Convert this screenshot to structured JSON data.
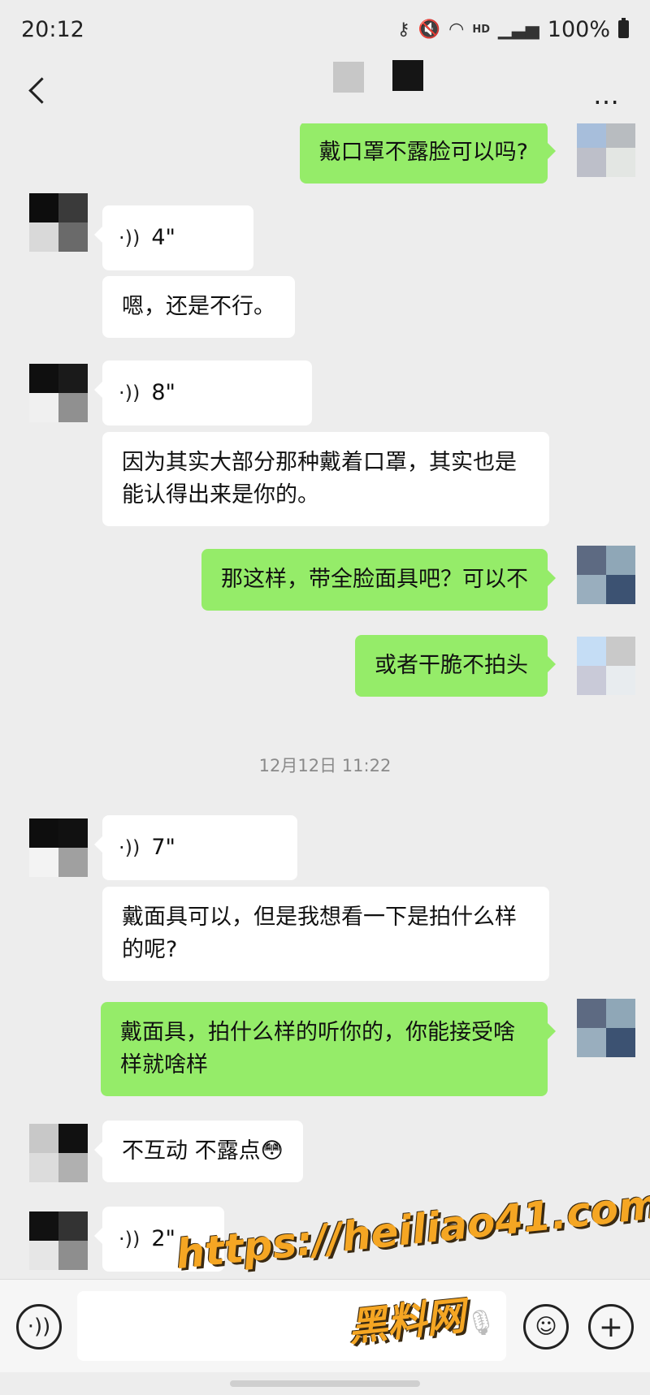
{
  "status_bar": {
    "time": "20:12",
    "battery": "100%",
    "icons": [
      "key-icon",
      "mute-icon",
      "wifi-icon",
      "hd-icon",
      "signal-icon",
      "battery-icon"
    ],
    "hd_label": "HD"
  },
  "nav": {
    "back_icon": "chevron-left-icon",
    "more_label": "…"
  },
  "messages": [
    {
      "side": "out",
      "type": "text",
      "text": "戴口罩不露脸可以吗?"
    },
    {
      "side": "in",
      "type": "voice",
      "duration": "4\""
    },
    {
      "side": "in",
      "type": "text",
      "text": "嗯，还是不行。"
    },
    {
      "side": "in",
      "type": "voice",
      "duration": "8\""
    },
    {
      "side": "in",
      "type": "text",
      "text": "因为其实大部分那种戴着口罩，其实也是能认得出来是你的。"
    },
    {
      "side": "out",
      "type": "text",
      "text": "那这样，带全脸面具吧？可以不"
    },
    {
      "side": "out",
      "type": "text",
      "text": "或者干脆不拍头"
    },
    {
      "side": "in",
      "type": "voice",
      "duration": "7\""
    },
    {
      "side": "in",
      "type": "text",
      "text": "戴面具可以，但是我想看一下是拍什么样的呢?"
    },
    {
      "side": "out",
      "type": "text",
      "text": "戴面具，拍什么样的听你的，你能接受啥样就啥样"
    },
    {
      "side": "in",
      "type": "text",
      "text": "不互动 不露点"
    },
    {
      "side": "in",
      "type": "voice",
      "duration": "2\""
    }
  ],
  "emoji_label": "😳",
  "timestamp": "12月12日 11:22",
  "input_bar": {
    "voice_icon": "voice-toggle-icon",
    "emoji_icon": "emoji-icon",
    "plus_icon": "plus-icon",
    "input_value": ""
  },
  "watermark": {
    "url": "https://heiliao41.com",
    "site": "黑料网"
  }
}
